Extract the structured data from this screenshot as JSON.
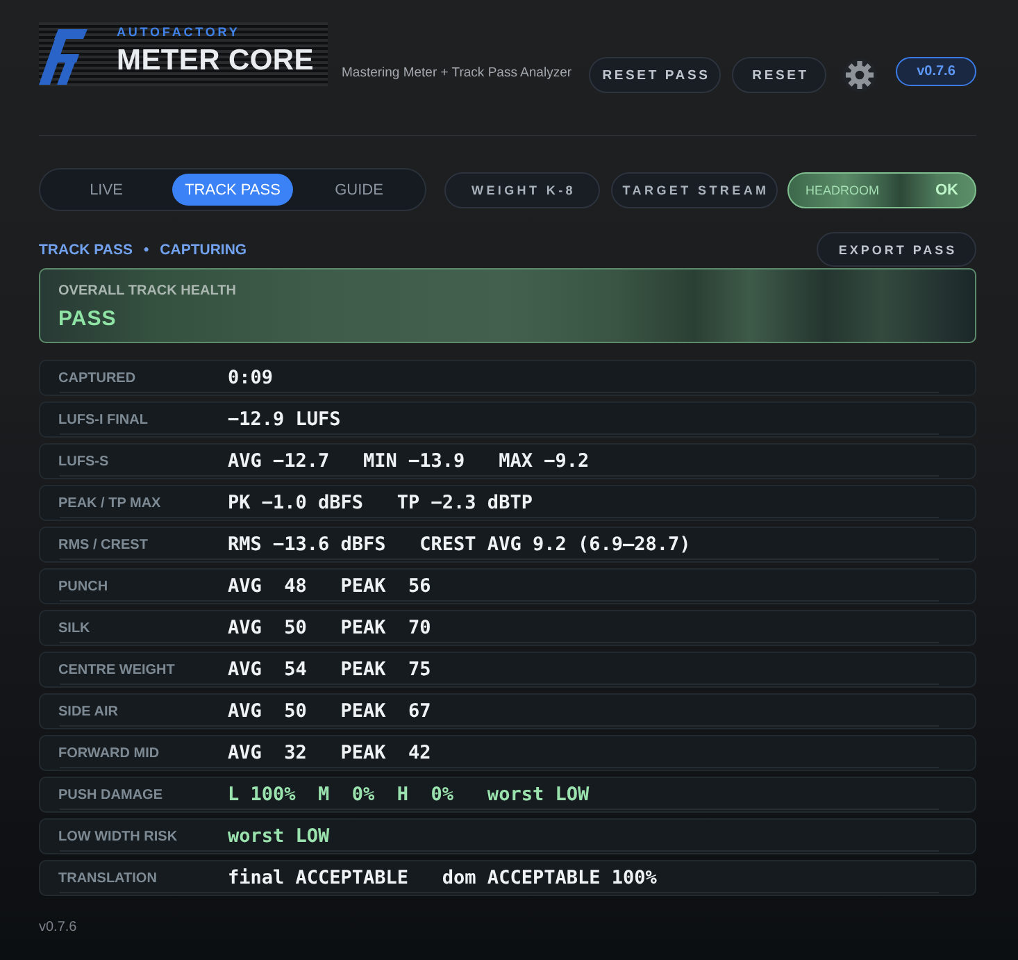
{
  "header": {
    "brand": "AUTOFACTORY",
    "product": "METER CORE",
    "subtitle": "Mastering Meter + Track Pass Analyzer",
    "buttons": [
      "RESET PASS",
      "RESET"
    ],
    "version": "v0.7.6"
  },
  "tabs": [
    {
      "label": "LIVE",
      "selected": false
    },
    {
      "label": "TRACK PASS",
      "selected": true
    },
    {
      "label": "GUIDE",
      "selected": false
    }
  ],
  "toggles": [
    "WEIGHT K-8",
    "TARGET STREAM"
  ],
  "headroom": {
    "label": "HEADROOM",
    "value": "OK",
    "ok": true
  },
  "status": {
    "mode": "TRACK PASS",
    "separator": "•",
    "state": "CAPTURING"
  },
  "export_button": "EXPORT PASS",
  "health": {
    "title": "OVERALL TRACK HEALTH",
    "result": "PASS",
    "ok": true
  },
  "metrics": [
    {
      "label": "CAPTURED",
      "value": "0:09",
      "highlighted": false
    },
    {
      "label": "LUFS-I FINAL",
      "value": "−12.9 LUFS",
      "highlighted": false
    },
    {
      "label": "LUFS-S",
      "value": "AVG −12.7   MIN −13.9   MAX −9.2",
      "highlighted": false
    },
    {
      "label": "PEAK / TP MAX",
      "value": "PK −1.0 dBFS   TP −2.3 dBTP",
      "highlighted": false
    },
    {
      "label": "RMS / CREST",
      "value": "RMS −13.6 dBFS   CREST AVG 9.2 (6.9–28.7)",
      "highlighted": false
    },
    {
      "label": "PUNCH",
      "value": "AVG  48   PEAK  56",
      "highlighted": false
    },
    {
      "label": "SILK",
      "value": "AVG  50   PEAK  70",
      "highlighted": false
    },
    {
      "label": "CENTRE WEIGHT",
      "value": "AVG  54   PEAK  75",
      "highlighted": false
    },
    {
      "label": "SIDE AIR",
      "value": "AVG  50   PEAK  67",
      "highlighted": false
    },
    {
      "label": "FORWARD MID",
      "value": "AVG  32   PEAK  42",
      "highlighted": false
    },
    {
      "label": "PUSH DAMAGE",
      "value": "L 100%  M  0%  H  0%   worst LOW",
      "highlighted": true
    },
    {
      "label": "LOW WIDTH RISK",
      "value": "worst LOW",
      "highlighted": true
    },
    {
      "label": "TRANSLATION",
      "value": "final ACCEPTABLE   dom ACCEPTABLE 100%",
      "highlighted": false
    }
  ],
  "footer": {
    "version": "v0.7.6"
  }
}
